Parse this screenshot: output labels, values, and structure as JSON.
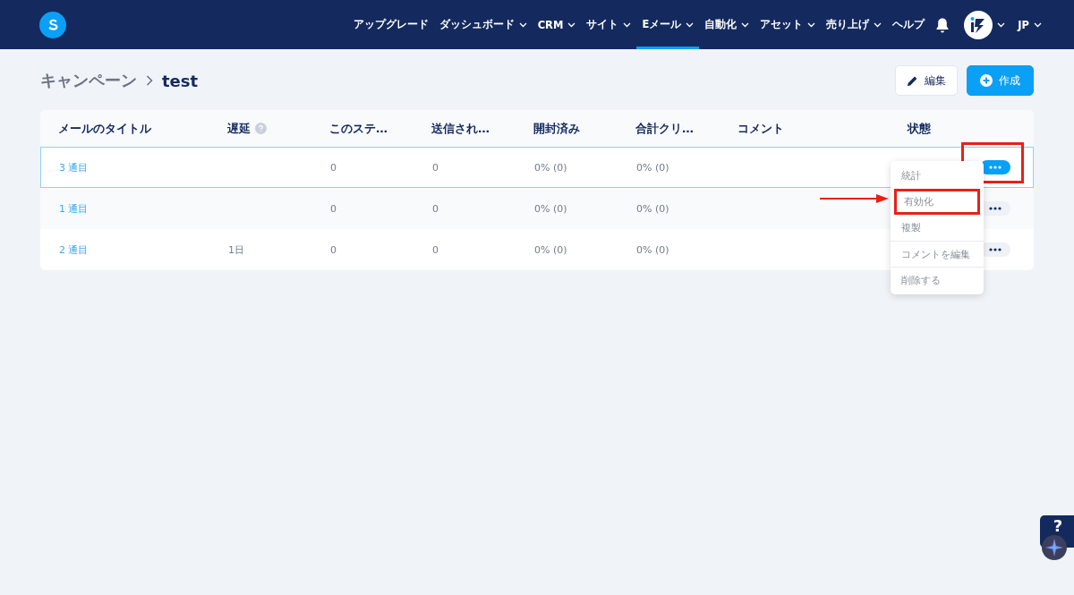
{
  "nav": {
    "items": [
      {
        "label": "アップグレード",
        "dropdown": false,
        "selected": false
      },
      {
        "label": "ダッシュボード",
        "dropdown": true,
        "selected": false
      },
      {
        "label": "CRM",
        "dropdown": true,
        "selected": false
      },
      {
        "label": "サイト",
        "dropdown": true,
        "selected": false
      },
      {
        "label": "Eメール",
        "dropdown": true,
        "selected": true
      },
      {
        "label": "自動化",
        "dropdown": true,
        "selected": false
      },
      {
        "label": "アセット",
        "dropdown": true,
        "selected": false
      },
      {
        "label": "売り上げ",
        "dropdown": true,
        "selected": false
      },
      {
        "label": "ヘルプ",
        "dropdown": false,
        "selected": false
      }
    ],
    "language": "JP"
  },
  "breadcrumb": {
    "parent": "キャンペーン",
    "current": "test"
  },
  "actions": [
    {
      "kind": "edit",
      "label": "編集"
    },
    {
      "kind": "create",
      "label": "作成"
    }
  ],
  "table": {
    "columns": [
      "メールのタイトル",
      "遅延",
      "このステ…",
      "送信され…",
      "開封済み",
      "合計クリ…",
      "コメント",
      "状態"
    ],
    "rows": [
      {
        "title": "3 通目",
        "delay": "",
        "steps": "0",
        "sent": "0",
        "opened": "0% (0)",
        "clicks": "0% (0)",
        "selected": true,
        "menu_open": true,
        "highlighted": true
      },
      {
        "title": "1 通目",
        "delay": "",
        "steps": "0",
        "sent": "0",
        "opened": "0% (0)",
        "clicks": "0% (0)",
        "selected": false,
        "menu_open": false,
        "highlighted": false
      },
      {
        "title": "2 通目",
        "delay": "1日",
        "steps": "0",
        "sent": "0",
        "opened": "0% (0)",
        "clicks": "0% (0)",
        "selected": false,
        "menu_open": false,
        "highlighted": false
      }
    ]
  },
  "row_menu": {
    "items": [
      {
        "label": "統計",
        "divider": false,
        "highlighted": false
      },
      {
        "label": "有効化",
        "divider": false,
        "highlighted": true
      },
      {
        "label": "複製",
        "divider": false,
        "highlighted": false
      },
      {
        "label": "コメントを編集",
        "divider": true,
        "highlighted": false
      },
      {
        "label": "削除する",
        "divider": true,
        "highlighted": false
      }
    ]
  },
  "help_widget": {
    "label": "?"
  }
}
